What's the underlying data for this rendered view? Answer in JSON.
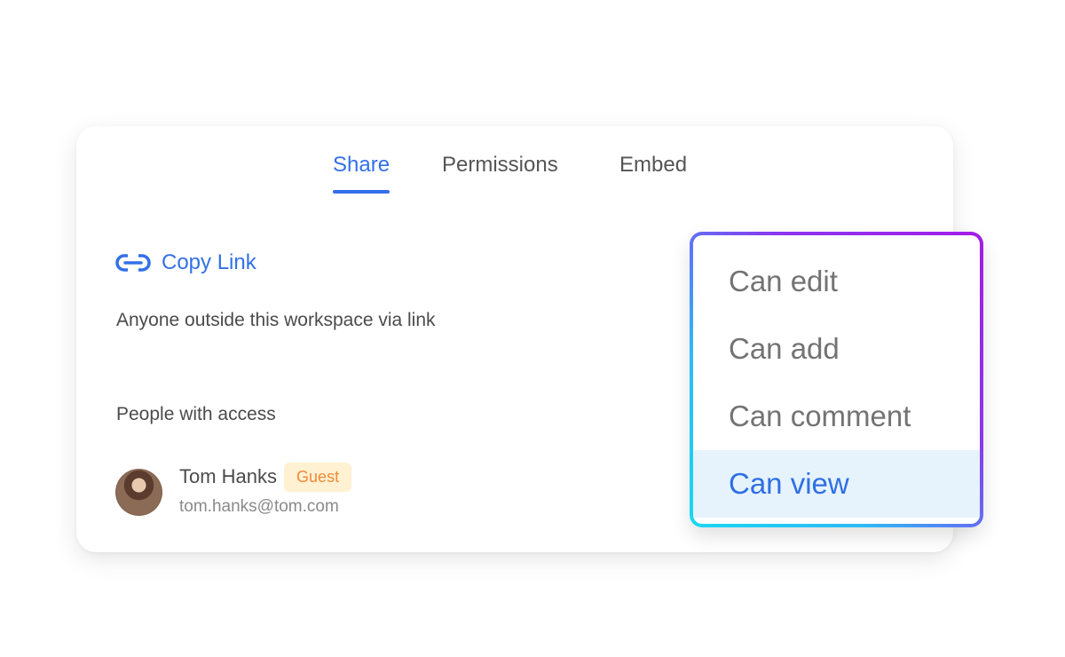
{
  "tabs": [
    {
      "label": "Share",
      "active": true
    },
    {
      "label": "Permissions",
      "active": false
    },
    {
      "label": "Embed",
      "active": false
    }
  ],
  "copy_link": {
    "label": "Copy Link",
    "icon": "link-icon"
  },
  "access_text": "Anyone outside this workspace via link",
  "people_section": {
    "title": "People with access",
    "people": [
      {
        "name": "Tom Hanks",
        "badge": "Guest",
        "email": "tom.hanks@tom.com"
      }
    ]
  },
  "permissions_dropdown": {
    "options": [
      "Can edit",
      "Can add",
      "Can comment",
      "Can view"
    ],
    "selected": "Can view"
  },
  "colors": {
    "accent": "#3370e8",
    "badge_bg": "#fff1d2",
    "badge_text": "#f08a3a",
    "selected_bg": "#e6f3fd",
    "dropdown_border_start": "#18d8f3",
    "dropdown_border_end": "#a31ce8"
  }
}
